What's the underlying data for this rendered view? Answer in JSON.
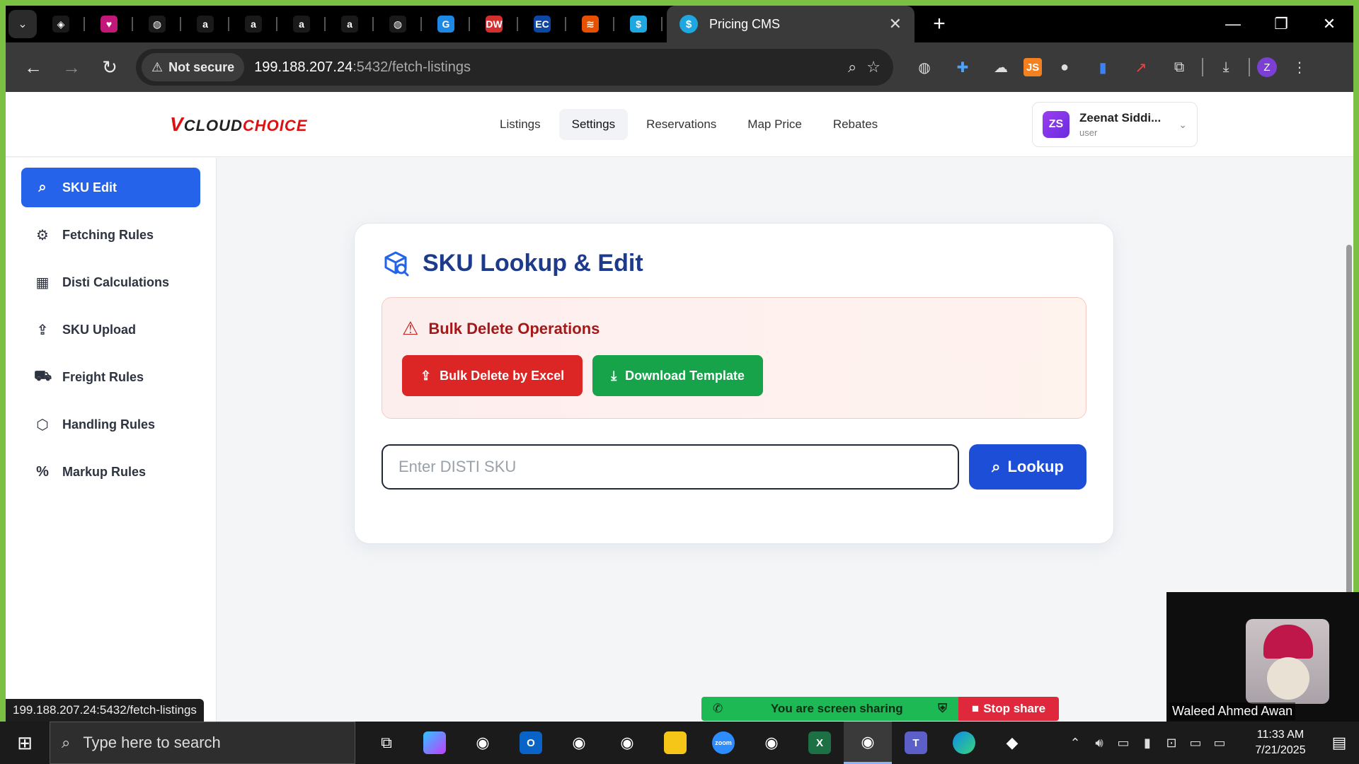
{
  "browser": {
    "tabs_favicons": [
      "apps-icon",
      "heart-icon",
      "globe-icon",
      "amazon-icon",
      "amazon-icon",
      "amazon-icon",
      "amazon-icon",
      "globe-icon",
      "g-icon",
      "dw-icon",
      "ec-icon",
      "stack-icon",
      "dollar-icon"
    ],
    "tab_fav_labels": [
      "◈",
      "♥",
      "◍",
      "a",
      "a",
      "a",
      "a",
      "◍",
      "G",
      "DW",
      "EC",
      "≋",
      "$"
    ],
    "tab_fav_colors": [
      "#1a1a1a",
      "#c2187a",
      "#1a1a1a",
      "#1a1a1a",
      "#1a1a1a",
      "#1a1a1a",
      "#1a1a1a",
      "#1a1a1a",
      "#1e88e5",
      "#d32f2f",
      "#0d47a1",
      "#e65100",
      "#1ea7e0"
    ],
    "active_tab": {
      "title": "Pricing CMS",
      "favicon": "$"
    },
    "security_label": "Not secure",
    "url_host": "199.188.207.24",
    "url_rest": ":5432/fetch-listings",
    "profile_initial": "Z",
    "js_ext": "JS",
    "status_url": "199.188.207.24:5432/fetch-listings"
  },
  "header": {
    "logo_v": "V",
    "logo_cloud": "CLOUD",
    "logo_choice": "CHOICE",
    "nav": [
      {
        "label": "Listings",
        "active": false
      },
      {
        "label": "Settings",
        "active": true
      },
      {
        "label": "Reservations",
        "active": false
      },
      {
        "label": "Map Price",
        "active": false
      },
      {
        "label": "Rebates",
        "active": false
      }
    ],
    "user": {
      "initials": "ZS",
      "name": "Zeenat Siddi...",
      "role": "user"
    }
  },
  "sidebar": {
    "items": [
      {
        "label": "SKU Edit",
        "icon": "search-icon",
        "glyph": "⌕",
        "active": true
      },
      {
        "label": "Fetching Rules",
        "icon": "gear-icon",
        "glyph": "⚙",
        "active": false
      },
      {
        "label": "Disti Calculations",
        "icon": "calculator-icon",
        "glyph": "▦",
        "active": false
      },
      {
        "label": "SKU Upload",
        "icon": "upload-icon",
        "glyph": "⇪",
        "active": false
      },
      {
        "label": "Freight Rules",
        "icon": "truck-icon",
        "glyph": "⛟",
        "active": false
      },
      {
        "label": "Handling Rules",
        "icon": "package-icon",
        "glyph": "⬡",
        "active": false
      },
      {
        "label": "Markup Rules",
        "icon": "percent-icon",
        "glyph": "%",
        "active": false
      }
    ]
  },
  "card": {
    "title": "SKU Lookup & Edit",
    "bulk_title": "Bulk Delete Operations",
    "bulk_delete_label": "Bulk Delete by Excel",
    "download_template_label": "Download Template",
    "sku_placeholder": "Enter DISTI SKU",
    "lookup_label": "Lookup"
  },
  "screen_share": {
    "message": "You are screen sharing",
    "stop_label": "Stop share"
  },
  "video": {
    "participant": "Waleed Ahmed Awan"
  },
  "taskbar": {
    "search_placeholder": "Type here to search",
    "time": "11:33 AM",
    "date": "7/21/2025"
  },
  "colors": {
    "primary": "#2563eb",
    "danger": "#dc2626",
    "success": "#16a34a",
    "title": "#1e3a8a"
  }
}
